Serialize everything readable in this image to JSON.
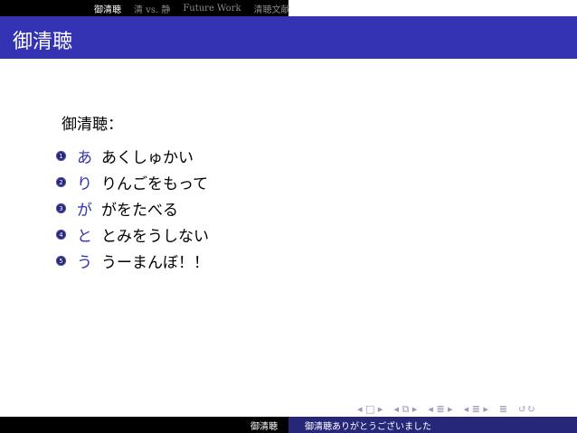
{
  "topnav": {
    "items": [
      {
        "label": "御清聴",
        "active": true
      },
      {
        "label": "清 vs. 静",
        "active": false
      },
      {
        "label": "Future Work",
        "active": false
      },
      {
        "label": "清聴文献",
        "active": false
      }
    ]
  },
  "frame": {
    "title": "御清聴"
  },
  "content": {
    "heading": "御清聴：",
    "items": [
      {
        "number": "1",
        "lead": "あ",
        "rest": "あくしゅかい"
      },
      {
        "number": "2",
        "lead": "り",
        "rest": "りんごをもって"
      },
      {
        "number": "3",
        "lead": "が",
        "rest": "がをたべる"
      },
      {
        "number": "4",
        "lead": "と",
        "rest": "とみをうしない"
      },
      {
        "number": "5",
        "lead": "う",
        "rest": "うーまんぼ！！"
      }
    ]
  },
  "navigation": {
    "symbols": [
      "◂ □ ▸",
      "◂ ⧉ ▸",
      "◂ ≣ ▸",
      "◂ ≣ ▸",
      "≣",
      "↺↻"
    ]
  },
  "footer": {
    "left": "御清聴",
    "right": "御清聴ありがとうございました"
  },
  "colors": {
    "accent": "#3333b3",
    "footer_blue": "#27277a"
  }
}
